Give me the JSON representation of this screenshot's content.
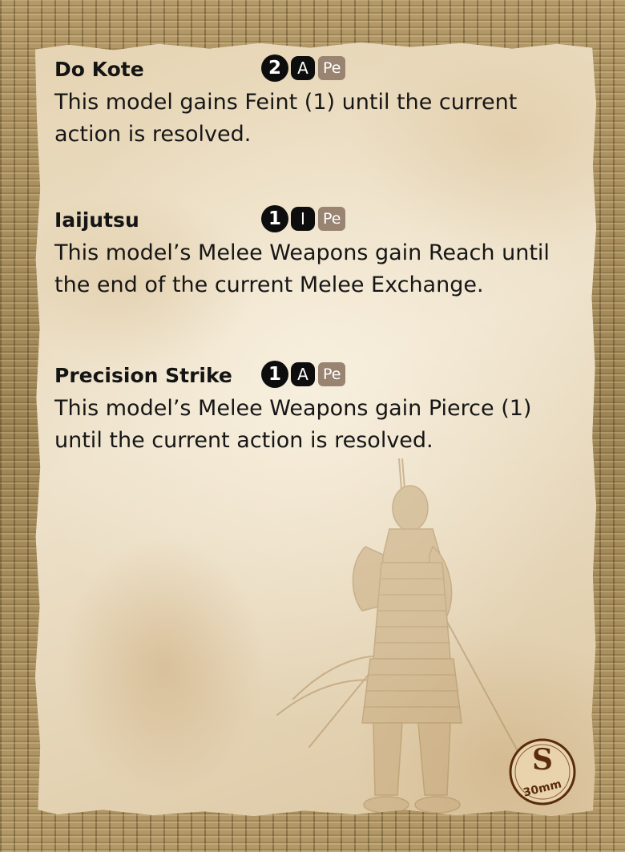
{
  "abilities": [
    {
      "name": "Do Kote",
      "cost": "2",
      "type": "A",
      "tag": "Pe",
      "description": "This model gains Feint (1) until the current action is resolved."
    },
    {
      "name": "Iaijutsu",
      "cost": "1",
      "type": "I",
      "tag": "Pe",
      "description": "This model’s Melee Weapons gain Reach until the end of the current Melee Exchange."
    },
    {
      "name": "Precision Strike",
      "cost": "1",
      "type": "A",
      "tag": "Pe",
      "description": "This model’s Melee Weapons gain Pierce (1) until the current action is resolved."
    }
  ],
  "base_badge": {
    "letter": "S",
    "size": "30mm"
  },
  "colors": {
    "parchment": "#ede0c8",
    "tatami": "#a9905e",
    "cost_black": "#0d0d0d",
    "tag_brown": "#998371",
    "badge_brown": "#5a2c0c"
  },
  "illustration": "samurai-illustration"
}
